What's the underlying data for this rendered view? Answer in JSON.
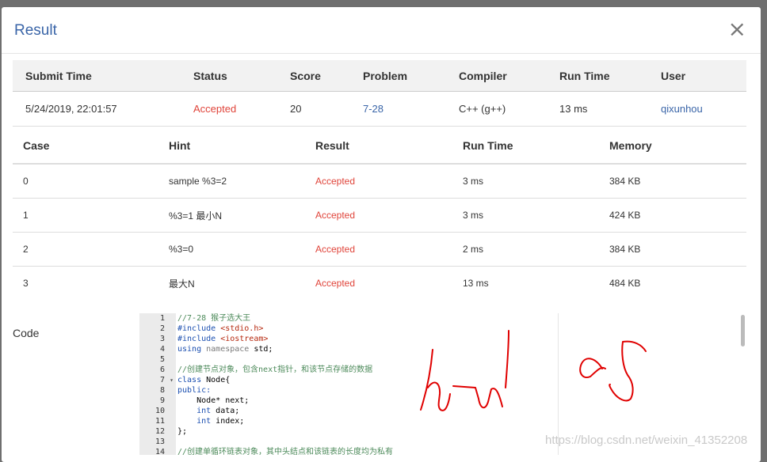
{
  "modal": {
    "title": "Result",
    "close": "×"
  },
  "submission": {
    "headers": [
      "Submit Time",
      "Status",
      "Score",
      "Problem",
      "Compiler",
      "Run Time",
      "User"
    ],
    "row": {
      "submit_time": "5/24/2019, 22:01:57",
      "status": "Accepted",
      "score": "20",
      "problem": "7-28",
      "compiler": "C++ (g++)",
      "run_time": "13 ms",
      "user": "qixunhou"
    }
  },
  "cases": {
    "headers": [
      "Case",
      "Hint",
      "Result",
      "Run Time",
      "Memory"
    ],
    "rows": [
      {
        "case": "0",
        "hint": "sample %3=2",
        "result": "Accepted",
        "run_time": "3 ms",
        "memory": "384 KB"
      },
      {
        "case": "1",
        "hint": "%3=1 最小N",
        "result": "Accepted",
        "run_time": "3 ms",
        "memory": "424 KB"
      },
      {
        "case": "2",
        "hint": "%3=0",
        "result": "Accepted",
        "run_time": "2 ms",
        "memory": "384 KB"
      },
      {
        "case": "3",
        "hint": "最大N",
        "result": "Accepted",
        "run_time": "13 ms",
        "memory": "484 KB"
      }
    ]
  },
  "code": {
    "label": "Code",
    "line_numbers": [
      "1",
      "2",
      "3",
      "4",
      "5",
      "6",
      "7",
      "8",
      "9",
      "10",
      "11",
      "12",
      "13",
      "14"
    ],
    "lines": [
      "//7-28 猴子选大王",
      "#include <stdio.h>",
      "#include <iostream>",
      "using namespace std;",
      "",
      "//创建节点对象，包含next指针，和该节点存储的数据",
      "class Node{",
      "public:",
      "    Node* next;",
      "    int data;",
      "    int index;",
      "};",
      "",
      "//创建单循环链表对象，其中头结点和该链表的长度均为私有"
    ]
  },
  "watermark": "https://blog.csdn.net/weixin_41352208",
  "colors": {
    "accent": "#3a65a8",
    "accepted": "#e0443a",
    "annotation": "#e00000"
  }
}
